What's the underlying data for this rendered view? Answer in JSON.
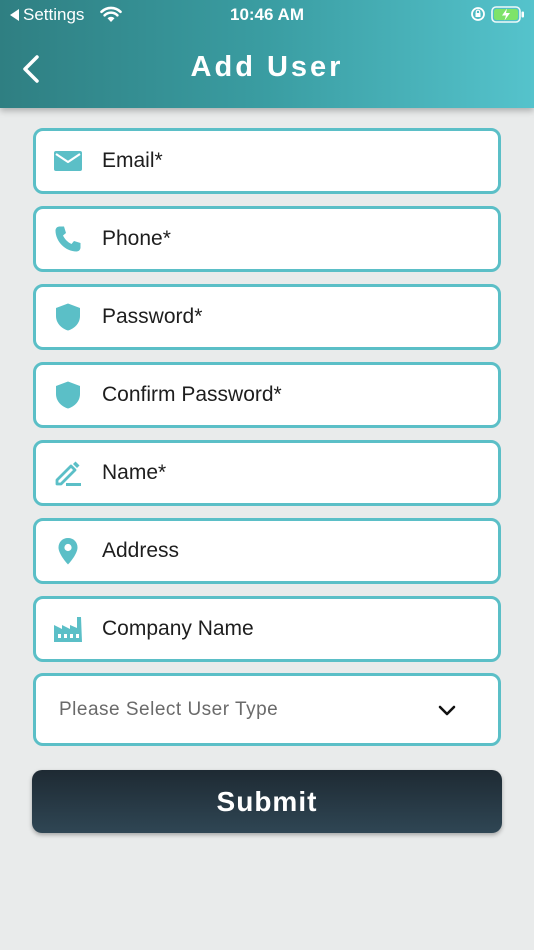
{
  "status_bar": {
    "back_label": "Settings",
    "time": "10:46 AM"
  },
  "header": {
    "title": "Add User"
  },
  "form": {
    "fields": [
      {
        "label": "Email*",
        "icon": "envelope-icon"
      },
      {
        "label": "Phone*",
        "icon": "phone-icon"
      },
      {
        "label": "Password*",
        "icon": "shield-icon"
      },
      {
        "label": "Confirm Password*",
        "icon": "shield-icon"
      },
      {
        "label": "Name*",
        "icon": "pencil-icon"
      },
      {
        "label": "Address",
        "icon": "location-pin-icon"
      },
      {
        "label": "Company Name",
        "icon": "factory-icon"
      }
    ],
    "user_type_placeholder": "Please Select User Type",
    "submit_label": "Submit"
  },
  "colors": {
    "accent": "#5bbfc7",
    "header_start": "#2f7f82",
    "header_end": "#55c3cc",
    "submit_bg": "#24343e",
    "page_bg": "#e9ebeb"
  }
}
